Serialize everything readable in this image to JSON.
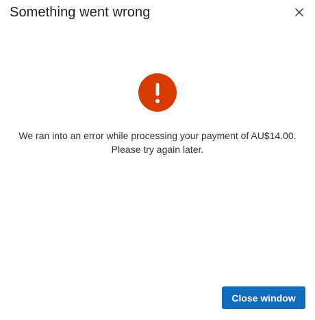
{
  "dialog": {
    "title": "Something went wrong",
    "close_icon": "close-icon",
    "status_icon": "error-exclamation-icon",
    "message_line1": "We ran into an error while processing your payment of AU$14.00.",
    "message_line2": "Please try again later.",
    "close_button_label": "Close window"
  },
  "colors": {
    "error_accent": "#d83b01",
    "primary_button": "#0f6cbd",
    "text": "#201f1e"
  }
}
